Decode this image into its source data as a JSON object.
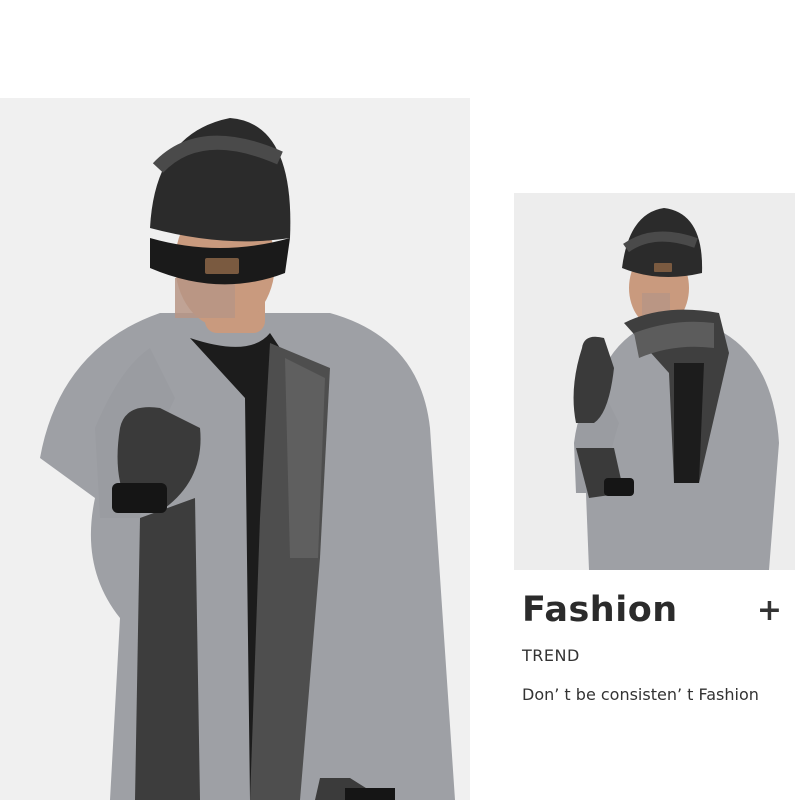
{
  "images": {
    "main": "man in knit beanie, scarf and gloves wearing grey sweater",
    "side": "man in knit beanie, scarf and gloves raising hand"
  },
  "caption": {
    "title": "Fashion",
    "expand_symbol": "+",
    "subtitle": "TREND",
    "tagline": "Don’ t be consisten’ t Fashion"
  },
  "colors": {
    "background": "#ffffff",
    "sweater": "#9a9ba0",
    "knit_dark": "#1c1c1c",
    "knit_grey": "#555555",
    "skin": "#c99a7e",
    "text": "#2b2b2b"
  }
}
